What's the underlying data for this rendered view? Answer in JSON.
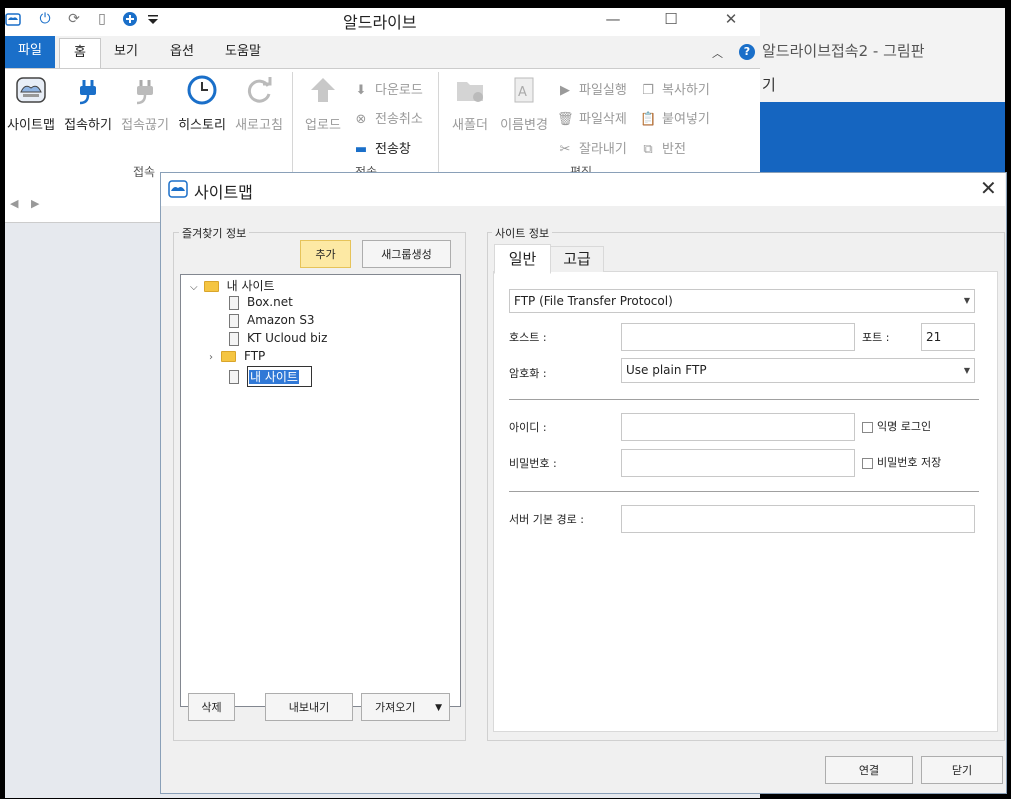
{
  "background_window": {
    "title": "알드라이브접속2 - 그림판",
    "sub": "기"
  },
  "app": {
    "title": "알드라이브",
    "quick_access_icons": [
      "app-logo-icon",
      "plug-icon",
      "refresh-icon",
      "document-icon",
      "plus-circle-icon",
      "dropdown-icon"
    ],
    "window_buttons": {
      "minimize": "—",
      "maximize": "☐",
      "close": "✕"
    },
    "tabs": [
      "파일",
      "홈",
      "보기",
      "옵션",
      "도움말"
    ],
    "help_icon": "?",
    "ribbon": {
      "connect_group": {
        "label": "접속",
        "buttons": [
          "사이트맵",
          "접속하기",
          "접속끊기",
          "히스토리",
          "새로고침"
        ]
      },
      "transfer_group": {
        "label": "전송",
        "upload": "업로드",
        "download": "다운로드",
        "cancel": "전송취소",
        "window": "전송창"
      },
      "edit_group": {
        "label": "편집",
        "new_folder": "새폴더",
        "rename": "이름변경",
        "run": "파일실행",
        "delete": "파일삭제",
        "cut": "잘라내기",
        "copy": "복사하기",
        "paste": "붙여넣기",
        "invert": "반전"
      }
    },
    "nav": {
      "back": "◀",
      "forward": "▶"
    }
  },
  "dialog": {
    "title": "사이트맵",
    "close": "✕",
    "favorites": {
      "legend": "즐겨찾기 정보",
      "add_button": "추가",
      "new_group_button": "새그룹생성",
      "tree": {
        "root": "내 사이트",
        "items": [
          "Box.net",
          "Amazon S3",
          "KT Ucloud biz"
        ],
        "folder": "FTP",
        "editing_item": "내 사이트"
      },
      "delete_button": "삭제",
      "export_button": "내보내기",
      "import_button": "가져오기"
    },
    "site_info": {
      "legend": "사이트 정보",
      "tabs": [
        "일반",
        "고급"
      ],
      "protocol": "FTP (File Transfer Protocol)",
      "host_label": "호스트 :",
      "host_value": "",
      "port_label": "포트 :",
      "port_value": "21",
      "encryption_label": "암호화 :",
      "encryption_value": "Use plain FTP",
      "id_label": "아이디 :",
      "id_value": "",
      "anonymous_label": "익명 로그인",
      "password_label": "비밀번호 :",
      "password_value": "",
      "save_password_label": "비밀번호 저장",
      "server_path_label": "서버 기본 경로 :",
      "server_path_value": ""
    },
    "connect_button": "연결",
    "close_button": "닫기"
  }
}
